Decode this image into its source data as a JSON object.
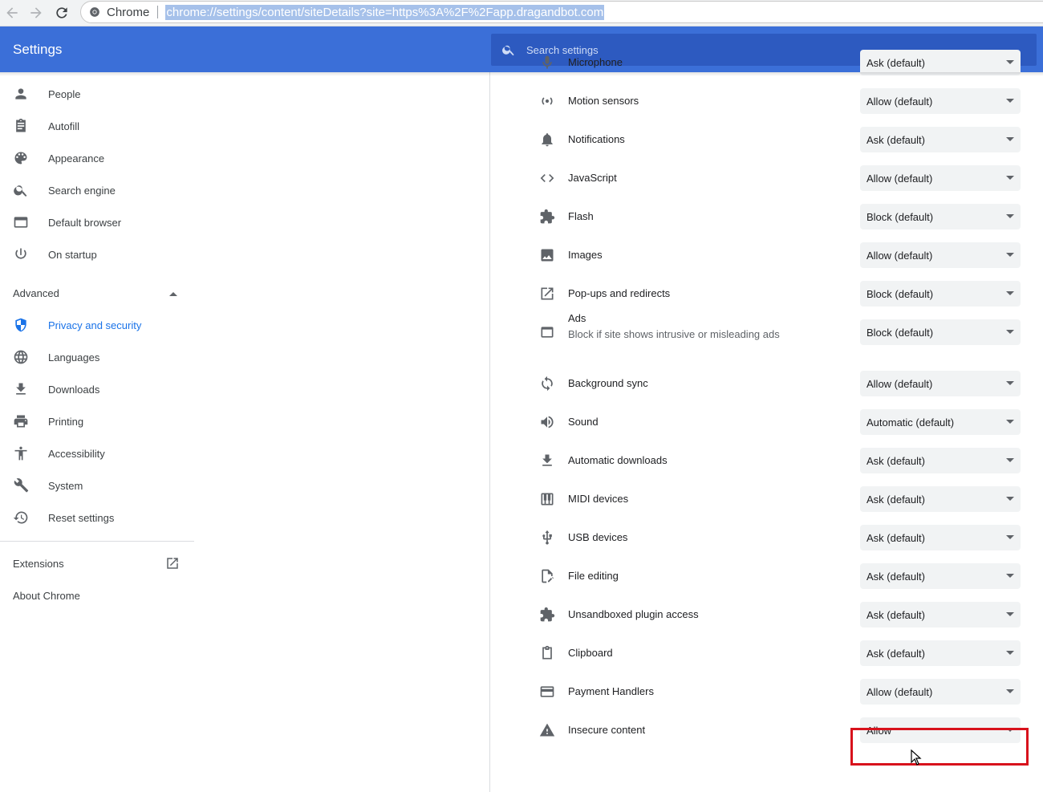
{
  "browser": {
    "chip_label": "Chrome",
    "url": "chrome://settings/content/siteDetails?site=https%3A%2F%2Fapp.dragandbot.com"
  },
  "header": {
    "title": "Settings",
    "search_placeholder": "Search settings"
  },
  "sidebar": {
    "items": [
      {
        "label": "People",
        "icon": "person-icon"
      },
      {
        "label": "Autofill",
        "icon": "clipboard-icon"
      },
      {
        "label": "Appearance",
        "icon": "palette-icon"
      },
      {
        "label": "Search engine",
        "icon": "search-icon"
      },
      {
        "label": "Default browser",
        "icon": "browser-window-icon"
      },
      {
        "label": "On startup",
        "icon": "power-icon"
      }
    ],
    "advanced_label": "Advanced",
    "advanced_items": [
      {
        "label": "Privacy and security",
        "icon": "shield-icon",
        "active": true
      },
      {
        "label": "Languages",
        "icon": "globe-icon"
      },
      {
        "label": "Downloads",
        "icon": "download-icon"
      },
      {
        "label": "Printing",
        "icon": "printer-icon"
      },
      {
        "label": "Accessibility",
        "icon": "accessibility-icon"
      },
      {
        "label": "System",
        "icon": "wrench-icon"
      },
      {
        "label": "Reset settings",
        "icon": "history-icon"
      }
    ],
    "extensions_label": "Extensions",
    "about_label": "About Chrome"
  },
  "permissions": [
    {
      "name": "Microphone",
      "value": "Ask (default)",
      "icon": "microphone-icon"
    },
    {
      "name": "Motion sensors",
      "value": "Allow (default)",
      "icon": "sensors-icon"
    },
    {
      "name": "Notifications",
      "value": "Ask (default)",
      "icon": "bell-icon"
    },
    {
      "name": "JavaScript",
      "value": "Allow (default)",
      "icon": "code-icon"
    },
    {
      "name": "Flash",
      "value": "Block (default)",
      "icon": "puzzle-icon"
    },
    {
      "name": "Images",
      "value": "Allow (default)",
      "icon": "image-icon"
    },
    {
      "name": "Pop-ups and redirects",
      "value": "Block (default)",
      "icon": "open-in-new-icon"
    },
    {
      "name": "Ads",
      "subtitle": "Block if site shows intrusive or misleading ads",
      "value": "Block (default)",
      "icon": "ads-window-icon"
    },
    {
      "name": "Background sync",
      "value": "Allow (default)",
      "icon": "sync-icon"
    },
    {
      "name": "Sound",
      "value": "Automatic (default)",
      "icon": "volume-icon"
    },
    {
      "name": "Automatic downloads",
      "value": "Ask (default)",
      "icon": "download-icon"
    },
    {
      "name": "MIDI devices",
      "value": "Ask (default)",
      "icon": "piano-icon"
    },
    {
      "name": "USB devices",
      "value": "Ask (default)",
      "icon": "usb-icon"
    },
    {
      "name": "File editing",
      "value": "Ask (default)",
      "icon": "file-edit-icon"
    },
    {
      "name": "Unsandboxed plugin access",
      "value": "Ask (default)",
      "icon": "puzzle-icon"
    },
    {
      "name": "Clipboard",
      "value": "Ask (default)",
      "icon": "clipboard-icon"
    },
    {
      "name": "Payment Handlers",
      "value": "Allow (default)",
      "icon": "credit-card-icon"
    },
    {
      "name": "Insecure content",
      "value": "Allow",
      "icon": "warning-icon",
      "highlighted": true
    }
  ],
  "colors": {
    "header_blue": "#3b6fd8",
    "active_blue": "#1a73e8",
    "highlight_red": "#d8121c"
  }
}
